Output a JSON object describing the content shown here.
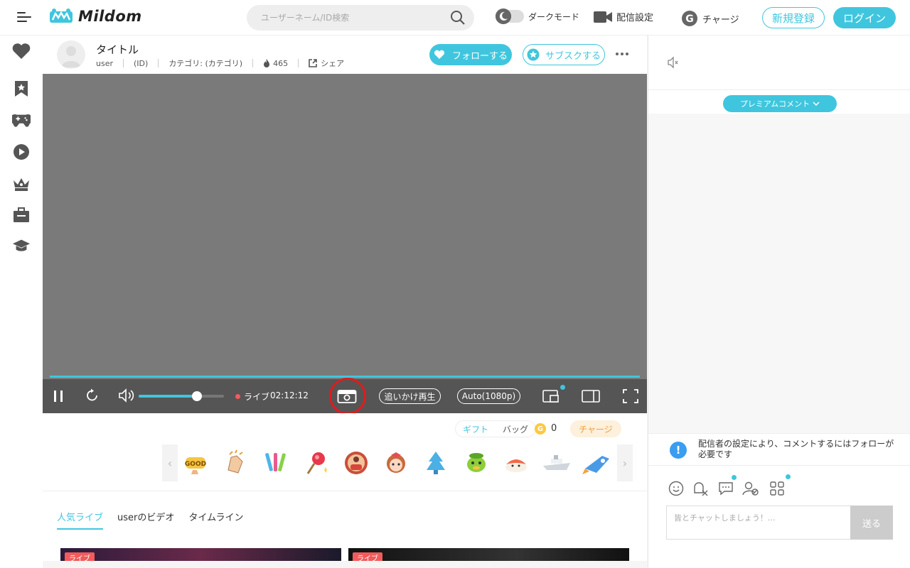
{
  "header": {
    "logo_text": "Mildom",
    "search_placeholder": "ユーザーネーム/ID検索",
    "dark_mode_label": "ダークモード",
    "stream_settings_label": "配信設定",
    "charge_label": "チャージ",
    "register_label": "新規登録",
    "login_label": "ログイン"
  },
  "sidebar": {
    "items": [
      "heart-icon",
      "bookmark-icon",
      "gamepad-icon",
      "play-icon",
      "crown-icon",
      "briefcase-icon",
      "graduation-cap-icon"
    ]
  },
  "stream": {
    "title": "タイトル",
    "user": "user",
    "id": "(ID)",
    "category": "カテゴリ: (カテゴリ)",
    "viewers": "465",
    "share": "シェア",
    "follow_label": "フォローする",
    "subscribe_label": "サブスクする"
  },
  "player": {
    "live_label": "ライブ",
    "time": "02:12:12",
    "catchup_label": "追いかけ再生",
    "quality_label": "Auto(1080p)",
    "volume_level": 0.68
  },
  "gifts": {
    "tab_gift": "ギフト",
    "tab_bag": "バッグ",
    "coin_symbol": "G",
    "coin_count": "0",
    "charge_label": "チャージ"
  },
  "tabs": [
    "人気ライブ",
    "userのビデオ",
    "タイムライン"
  ],
  "thumbnails": [
    "ライブ",
    "ライブ"
  ],
  "chat": {
    "premium_label": "プレミアムコメント",
    "notice": "配信者の設定により、コメントするにはフォローが必要です",
    "input_placeholder": "皆とチャットしましょう！...",
    "send_label": "送る"
  },
  "colors": {
    "accent": "#3fc6de",
    "live_red": "#f45b5b",
    "highlight_ring": "#e01c1c"
  }
}
